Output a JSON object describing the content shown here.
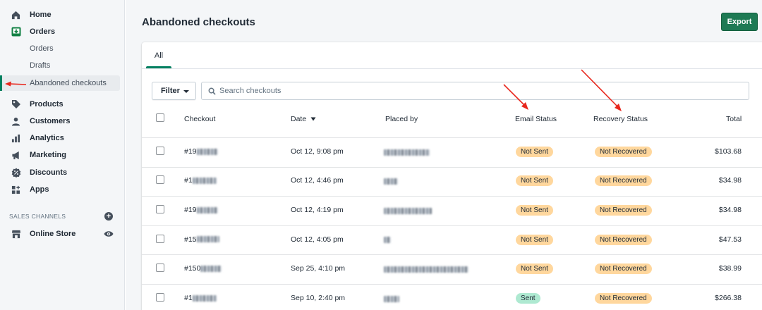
{
  "sidebar": {
    "items": [
      {
        "label": "Home",
        "icon": "home-icon"
      },
      {
        "label": "Orders",
        "icon": "orders-icon"
      },
      {
        "label": "Orders"
      },
      {
        "label": "Drafts"
      },
      {
        "label": "Abandoned checkouts"
      },
      {
        "label": "Products",
        "icon": "tag-icon"
      },
      {
        "label": "Customers",
        "icon": "person-icon"
      },
      {
        "label": "Analytics",
        "icon": "bar-chart-icon"
      },
      {
        "label": "Marketing",
        "icon": "megaphone-icon"
      },
      {
        "label": "Discounts",
        "icon": "discount-icon"
      },
      {
        "label": "Apps",
        "icon": "apps-icon"
      }
    ],
    "sales_channels_heading": "SALES CHANNELS",
    "online_store_label": "Online Store"
  },
  "page": {
    "title": "Abandoned checkouts",
    "export_label": "Export"
  },
  "tabs": [
    {
      "label": "All"
    }
  ],
  "filter_label": "Filter",
  "search": {
    "placeholder": "Search checkouts",
    "value": ""
  },
  "table": {
    "headers": {
      "checkout": "Checkout",
      "date": "Date",
      "placed_by": "Placed by",
      "email_status": "Email Status",
      "recovery_status": "Recovery Status",
      "total": "Total"
    },
    "rows": [
      {
        "checkout": "#19",
        "date": "Oct 12, 9:08 pm",
        "email_status": "Not Sent",
        "recovery_status": "Not Recovered",
        "total": "$103.68"
      },
      {
        "checkout": "#1",
        "date": "Oct 12, 4:46 pm",
        "email_status": "Not Sent",
        "recovery_status": "Not Recovered",
        "total": "$34.98"
      },
      {
        "checkout": "#19",
        "date": "Oct 12, 4:19 pm",
        "email_status": "Not Sent",
        "recovery_status": "Not Recovered",
        "total": "$34.98"
      },
      {
        "checkout": "#15",
        "date": "Oct 12, 4:05 pm",
        "email_status": "Not Sent",
        "recovery_status": "Not Recovered",
        "total": "$47.53"
      },
      {
        "checkout": "#150",
        "date": "Sep 25, 4:10 pm",
        "email_status": "Not Sent",
        "recovery_status": "Not Recovered",
        "total": "$38.99"
      },
      {
        "checkout": "#1",
        "date": "Sep 10, 2:40 pm",
        "email_status": "Sent",
        "recovery_status": "Not Recovered",
        "total": "$266.38"
      }
    ]
  },
  "colors": {
    "accent_green": "#008060",
    "export_green": "#1e7a54",
    "badge_warning": "#ffd79d",
    "badge_success": "#aee9d1",
    "annotation_red": "#e8261c"
  }
}
